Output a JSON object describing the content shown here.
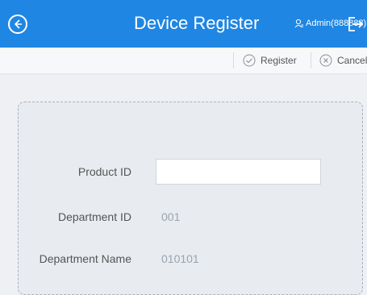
{
  "header": {
    "title": "Device Register",
    "user": "Admin(888888)"
  },
  "toolbar": {
    "register_label": "Register",
    "cancel_label": "Cancel"
  },
  "form": {
    "product_id": {
      "label": "Product ID",
      "value": ""
    },
    "department_id": {
      "label": "Department ID",
      "value": "001"
    },
    "department_name": {
      "label": "Department Name",
      "value": "010101"
    }
  }
}
